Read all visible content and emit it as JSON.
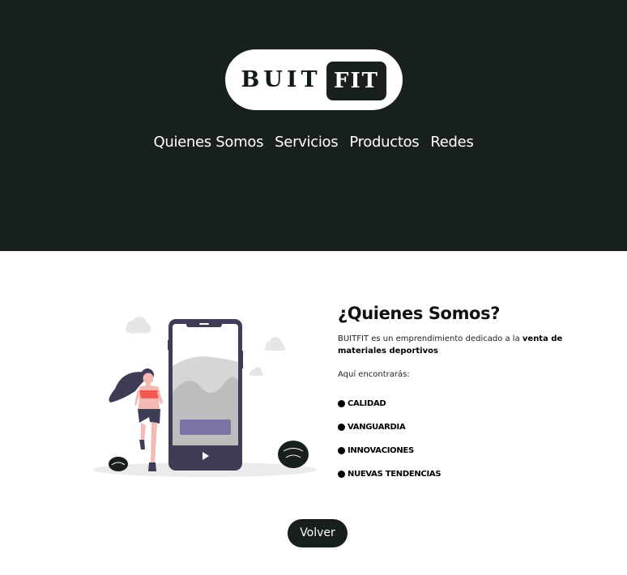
{
  "logo": {
    "part1": "BUIT",
    "part2": "FIT"
  },
  "nav": [
    {
      "label": "Quienes Somos"
    },
    {
      "label": "Servicios"
    },
    {
      "label": "Productos"
    },
    {
      "label": "Redes"
    }
  ],
  "about": {
    "title": "¿Quienes Somos?",
    "desc_prefix": "BUITFIT es un emprendimiento dedicado a la ",
    "desc_bold": "venta de materiales deportivos",
    "intro": "Aquí encontrarás:",
    "features": [
      "CALIDAD",
      "VANGUARDIA",
      "INNOVACIONES",
      "NUEVAS TENDENCIAS"
    ]
  },
  "back_button": "Volver",
  "colors": {
    "dark": "#18201c",
    "accent": "#7e73a7",
    "phone": "#3f3d56",
    "skin_top": "#f6574f"
  }
}
